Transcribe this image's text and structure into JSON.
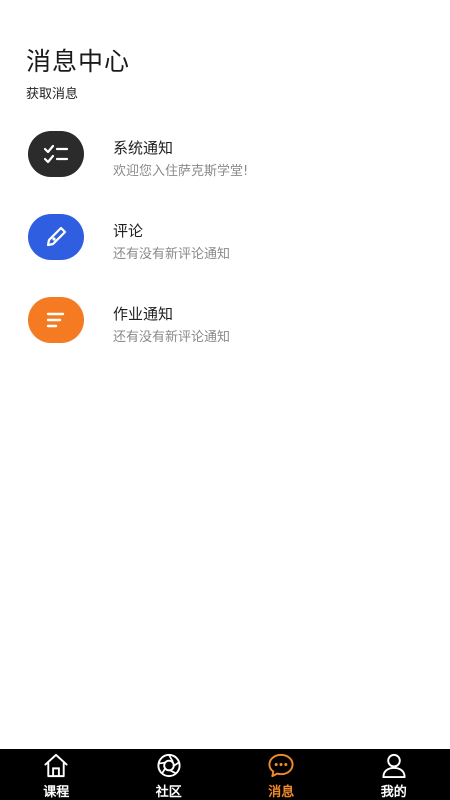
{
  "header": {
    "title": "消息中心",
    "subtitle": "获取消息"
  },
  "messages": [
    {
      "title": "系统通知",
      "desc": "欢迎您入住萨克斯学堂!",
      "icon": "checklist-icon",
      "color": "#2b2b2b"
    },
    {
      "title": "评论",
      "desc": "还有没有新评论通知",
      "icon": "pen-icon",
      "color": "#2f5fe0"
    },
    {
      "title": "作业通知",
      "desc": "还有没有新评论通知",
      "icon": "lines-icon",
      "color": "#f47b22"
    }
  ],
  "tabbar": {
    "active_color": "#f08a2a",
    "items": [
      {
        "label": "课程",
        "icon": "home-icon"
      },
      {
        "label": "社区",
        "icon": "aperture-icon"
      },
      {
        "label": "消息",
        "icon": "chat-bubble-icon",
        "active": true
      },
      {
        "label": "我的",
        "icon": "person-icon"
      }
    ]
  }
}
